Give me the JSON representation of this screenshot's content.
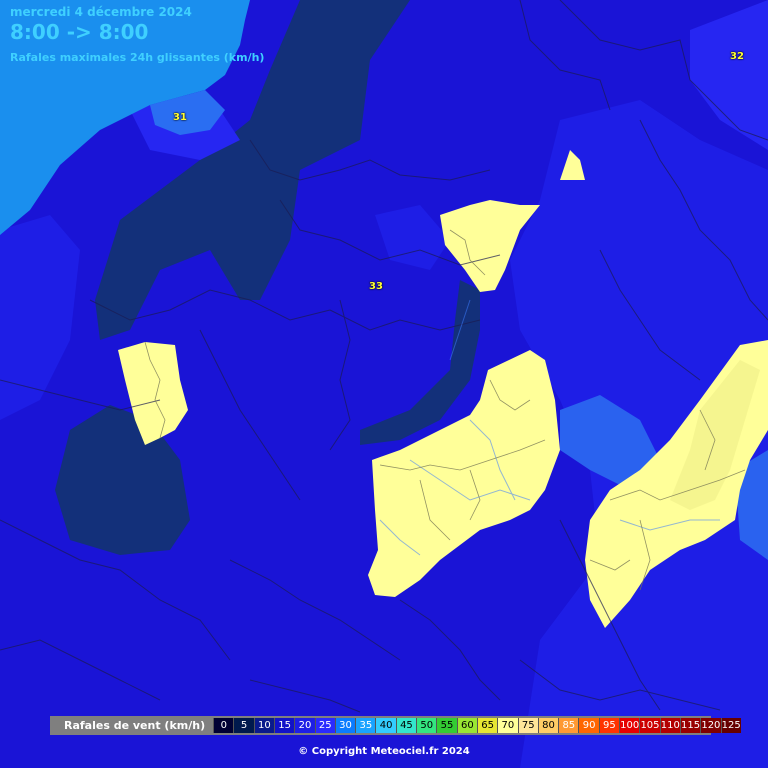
{
  "header": {
    "date": "mercredi 4 décembre 2024",
    "time_range": "8:00 -> 8:00",
    "subtitle": "Rafales maximales 24h glissantes (km/h)"
  },
  "labels": [
    {
      "id": "label-31",
      "text": "31"
    },
    {
      "id": "label-32",
      "text": "32"
    },
    {
      "id": "label-33",
      "text": "33"
    }
  ],
  "legend": {
    "title": "Rafales de vent (km/h)",
    "items": [
      {
        "value": "0",
        "color": "#000033",
        "text_color": "#ffffff"
      },
      {
        "value": "5",
        "color": "#00194d",
        "text_color": "#ffffff"
      },
      {
        "value": "10",
        "color": "#0a1a8c",
        "text_color": "#ffffff"
      },
      {
        "value": "15",
        "color": "#1212c8",
        "text_color": "#ffffff"
      },
      {
        "value": "20",
        "color": "#1e1ee6",
        "text_color": "#ffffff"
      },
      {
        "value": "25",
        "color": "#2a2aff",
        "text_color": "#ffffff"
      },
      {
        "value": "30",
        "color": "#0a7cff",
        "text_color": "#ffffff"
      },
      {
        "value": "35",
        "color": "#19a3ff",
        "text_color": "#ffffff"
      },
      {
        "value": "40",
        "color": "#33ccff",
        "text_color": "#000000"
      },
      {
        "value": "45",
        "color": "#33e6cc",
        "text_color": "#000000"
      },
      {
        "value": "50",
        "color": "#33e680",
        "text_color": "#000000"
      },
      {
        "value": "55",
        "color": "#33cc33",
        "text_color": "#000000"
      },
      {
        "value": "60",
        "color": "#99e633",
        "text_color": "#000000"
      },
      {
        "value": "65",
        "color": "#e6e633",
        "text_color": "#000000"
      },
      {
        "value": "70",
        "color": "#ffff99",
        "text_color": "#000000"
      },
      {
        "value": "75",
        "color": "#ffe699",
        "text_color": "#000000"
      },
      {
        "value": "80",
        "color": "#ffcc66",
        "text_color": "#000000"
      },
      {
        "value": "85",
        "color": "#ff9933",
        "text_color": "#ffffff"
      },
      {
        "value": "90",
        "color": "#ff6600",
        "text_color": "#ffffff"
      },
      {
        "value": "95",
        "color": "#ff3300",
        "text_color": "#ffffff"
      },
      {
        "value": "100",
        "color": "#e60000",
        "text_color": "#ffffff"
      },
      {
        "value": "105",
        "color": "#cc0000",
        "text_color": "#ffffff"
      },
      {
        "value": "110",
        "color": "#b30000",
        "text_color": "#ffffff"
      },
      {
        "value": "115",
        "color": "#990000",
        "text_color": "#ffffff"
      },
      {
        "value": "120",
        "color": "#800000",
        "text_color": "#ffffff"
      },
      {
        "value": "125",
        "color": "#660000",
        "text_color": "#ffffff"
      }
    ]
  },
  "copyright": "© Copyright Meteociel.fr 2024",
  "colors": {
    "sea": "#1a8fee",
    "band_30": "#0a7cff",
    "band_25": "#1e1ee6",
    "band_20": "#1212c8",
    "band_15": "#0a1a8c",
    "band_10": "#13307a",
    "band_70": "#ffff99",
    "accent": "#3fd0ff"
  }
}
